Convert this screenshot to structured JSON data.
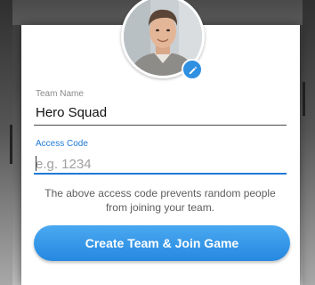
{
  "profile": {
    "avatar_icon": "person-photo-icon",
    "edit_icon": "pencil-icon",
    "accent": "#2f8fe0"
  },
  "form": {
    "team_name": {
      "label": "Team Name",
      "value": "Hero Squad"
    },
    "access_code": {
      "label": "Access Code",
      "value": "",
      "placeholder": "e.g. 1234",
      "focused": true
    },
    "note": "The above access code prevents random people from joining your team.",
    "submit_label": "Create Team & Join Game"
  },
  "colors": {
    "primary": "#2688e0",
    "focus": "#1f7ad6",
    "label": "#8a8a8a"
  }
}
